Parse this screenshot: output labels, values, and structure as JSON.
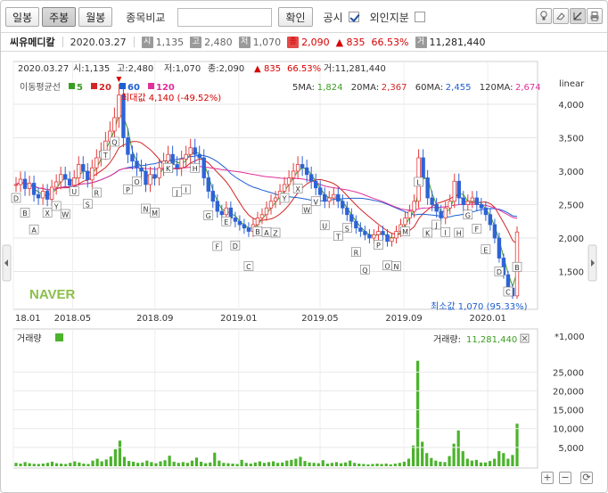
{
  "toolbar": {
    "tabs": [
      {
        "label": "일봉",
        "active": false
      },
      {
        "label": "주봉",
        "active": true
      },
      {
        "label": "월봉",
        "active": false
      }
    ],
    "compare_label": "종목비교",
    "compare_value": "",
    "confirm_label": "확인",
    "disclosure_label": "공시",
    "disclosure_checked": true,
    "foreign_label": "외인지분",
    "foreign_checked": false
  },
  "info": {
    "name": "씨유메디칼",
    "date": "2020.03.27",
    "open_badge": "시",
    "open": "1,135",
    "high_badge": "고",
    "high": "2,480",
    "low_badge": "저",
    "low": "1,070",
    "close_badge": "종",
    "close": "2,090",
    "change": "▲ 835",
    "change_pct": "66.53%",
    "vol_badge": "거",
    "volume": "11,281,440"
  },
  "chart_header": {
    "date": "2020.03.27",
    "open": "시:1,135",
    "high": "고:2,480",
    "low": "저:1,070",
    "close": "종:2,090",
    "arrow": "▲",
    "change": "835",
    "change_pct": "66.53%",
    "volume": "거:11,281,440",
    "ma_title": "이동평균선",
    "ma_legend": [
      {
        "label": "5",
        "color": "#3a9d23"
      },
      {
        "label": "20",
        "color": "#d22525"
      },
      {
        "label": "60",
        "color": "#1f5fd1"
      },
      {
        "label": "120",
        "color": "#e0309a"
      }
    ],
    "ma_values": [
      {
        "label": "5MA:",
        "value": "1,824",
        "color": "#3a9d23"
      },
      {
        "label": "20MA:",
        "value": "2,367",
        "color": "#d22525"
      },
      {
        "label": "60MA:",
        "value": "2,455",
        "color": "#1f5fd1"
      },
      {
        "label": "120MA:",
        "value": "2,674",
        "color": "#e0309a"
      }
    ],
    "scale_label": "linear",
    "max_label": "최대값 4,140 (-49.52%)",
    "min_label": "최소값 1,070 (95.33%)",
    "naver": "NAVER"
  },
  "chart_data": {
    "type": "candlestick",
    "price_ticks": [
      4000,
      3500,
      3000,
      2500,
      2000,
      1500
    ],
    "ylim": [
      960,
      4360
    ],
    "x_ticks": [
      "18.01",
      "2018.05",
      "2018.09",
      "2019.01",
      "2019.05",
      "2019.09",
      "2020.01"
    ],
    "price_series": [
      2800,
      2880,
      2740,
      2820,
      2650,
      2600,
      2700,
      2580,
      2760,
      2840,
      2950,
      2880,
      2790,
      2900,
      3100,
      3000,
      2870,
      3050,
      3200,
      3300,
      3450,
      3600,
      3800,
      4140,
      3500,
      3250,
      3150,
      3050,
      3000,
      2800,
      2950,
      2900,
      3050,
      3150,
      3250,
      3100,
      3050,
      3180,
      3250,
      3350,
      3250,
      3200,
      2900,
      2700,
      2550,
      2400,
      2350,
      2450,
      2300,
      2250,
      2200,
      2150,
      2100,
      2200,
      2300,
      2350,
      2450,
      2550,
      2600,
      2700,
      2800,
      2900,
      3000,
      3100,
      3050,
      2950,
      2850,
      2750,
      2650,
      2550,
      2600,
      2650,
      2550,
      2450,
      2350,
      2250,
      2150,
      2100,
      2050,
      2000,
      2050,
      2100,
      2050,
      1950,
      2000,
      2100,
      2200,
      2300,
      2400,
      2550,
      3200,
      2900,
      2600,
      2500,
      2400,
      2300,
      2450,
      2550,
      2850,
      2600,
      2500,
      2550,
      2600,
      2500,
      2450,
      2350,
      2200,
      2000,
      1700,
      1450,
      1250,
      1135,
      2090
    ],
    "ma_series": [
      {
        "name": "5",
        "color": "#3a9d23"
      },
      {
        "name": "20",
        "color": "#d22525"
      },
      {
        "name": "60",
        "color": "#1f5fd1"
      },
      {
        "name": "120",
        "color": "#e0309a"
      }
    ],
    "annotation_letters": [
      "D",
      "B",
      "A",
      "X",
      "Y",
      "W",
      "U",
      "S",
      "R",
      "T",
      "Q",
      "P",
      "O",
      "N",
      "M",
      "K",
      "J",
      "I",
      "H",
      "G",
      "F",
      "E",
      "D",
      "C",
      "B",
      "A",
      "Z",
      "Y",
      "X",
      "W",
      "V",
      "U",
      "T",
      "S",
      "R",
      "Q",
      "P",
      "O",
      "N",
      "M",
      "L",
      "K",
      "J",
      "I",
      "H",
      "G",
      "F",
      "E",
      "D",
      "C",
      "B"
    ],
    "volume_label": "거래량",
    "volume_value_label": "거래량:",
    "volume_value": "11,281,440",
    "volume_unit": "*1,000",
    "volume_ticks": [
      25000,
      20000,
      15000,
      10000,
      5000
    ],
    "volume_ylim": [
      0,
      31000
    ],
    "volume": [
      900,
      700,
      1100,
      800,
      650,
      600,
      700,
      900,
      1200,
      800,
      700,
      600,
      900,
      1300,
      1000,
      700,
      600,
      1500,
      2000,
      1300,
      1800,
      2600,
      4500,
      6800,
      2500,
      1400,
      1200,
      900,
      1000,
      1500,
      1100,
      800,
      1300,
      1600,
      2800,
      1200,
      900,
      1100,
      900,
      1500,
      2300,
      1200,
      800,
      1000,
      3600,
      1500,
      900,
      800,
      700,
      600,
      1700,
      900,
      700,
      1000,
      1300,
      900,
      1100,
      1300,
      900,
      1000,
      1500,
      1700,
      2000,
      2500,
      1400,
      1000,
      900,
      800,
      1600,
      700,
      900,
      1100,
      800,
      1000,
      1500,
      900,
      700,
      600,
      500,
      600,
      700,
      600,
      700,
      500,
      700,
      900,
      1200,
      2000,
      5500,
      28000,
      6500,
      3500,
      2200,
      1500,
      1200,
      1100,
      2700,
      6000,
      9500,
      4000,
      2000,
      1500,
      1700,
      1000,
      1000,
      1400,
      2000,
      4000,
      3500,
      2000,
      3000,
      11300
    ]
  }
}
